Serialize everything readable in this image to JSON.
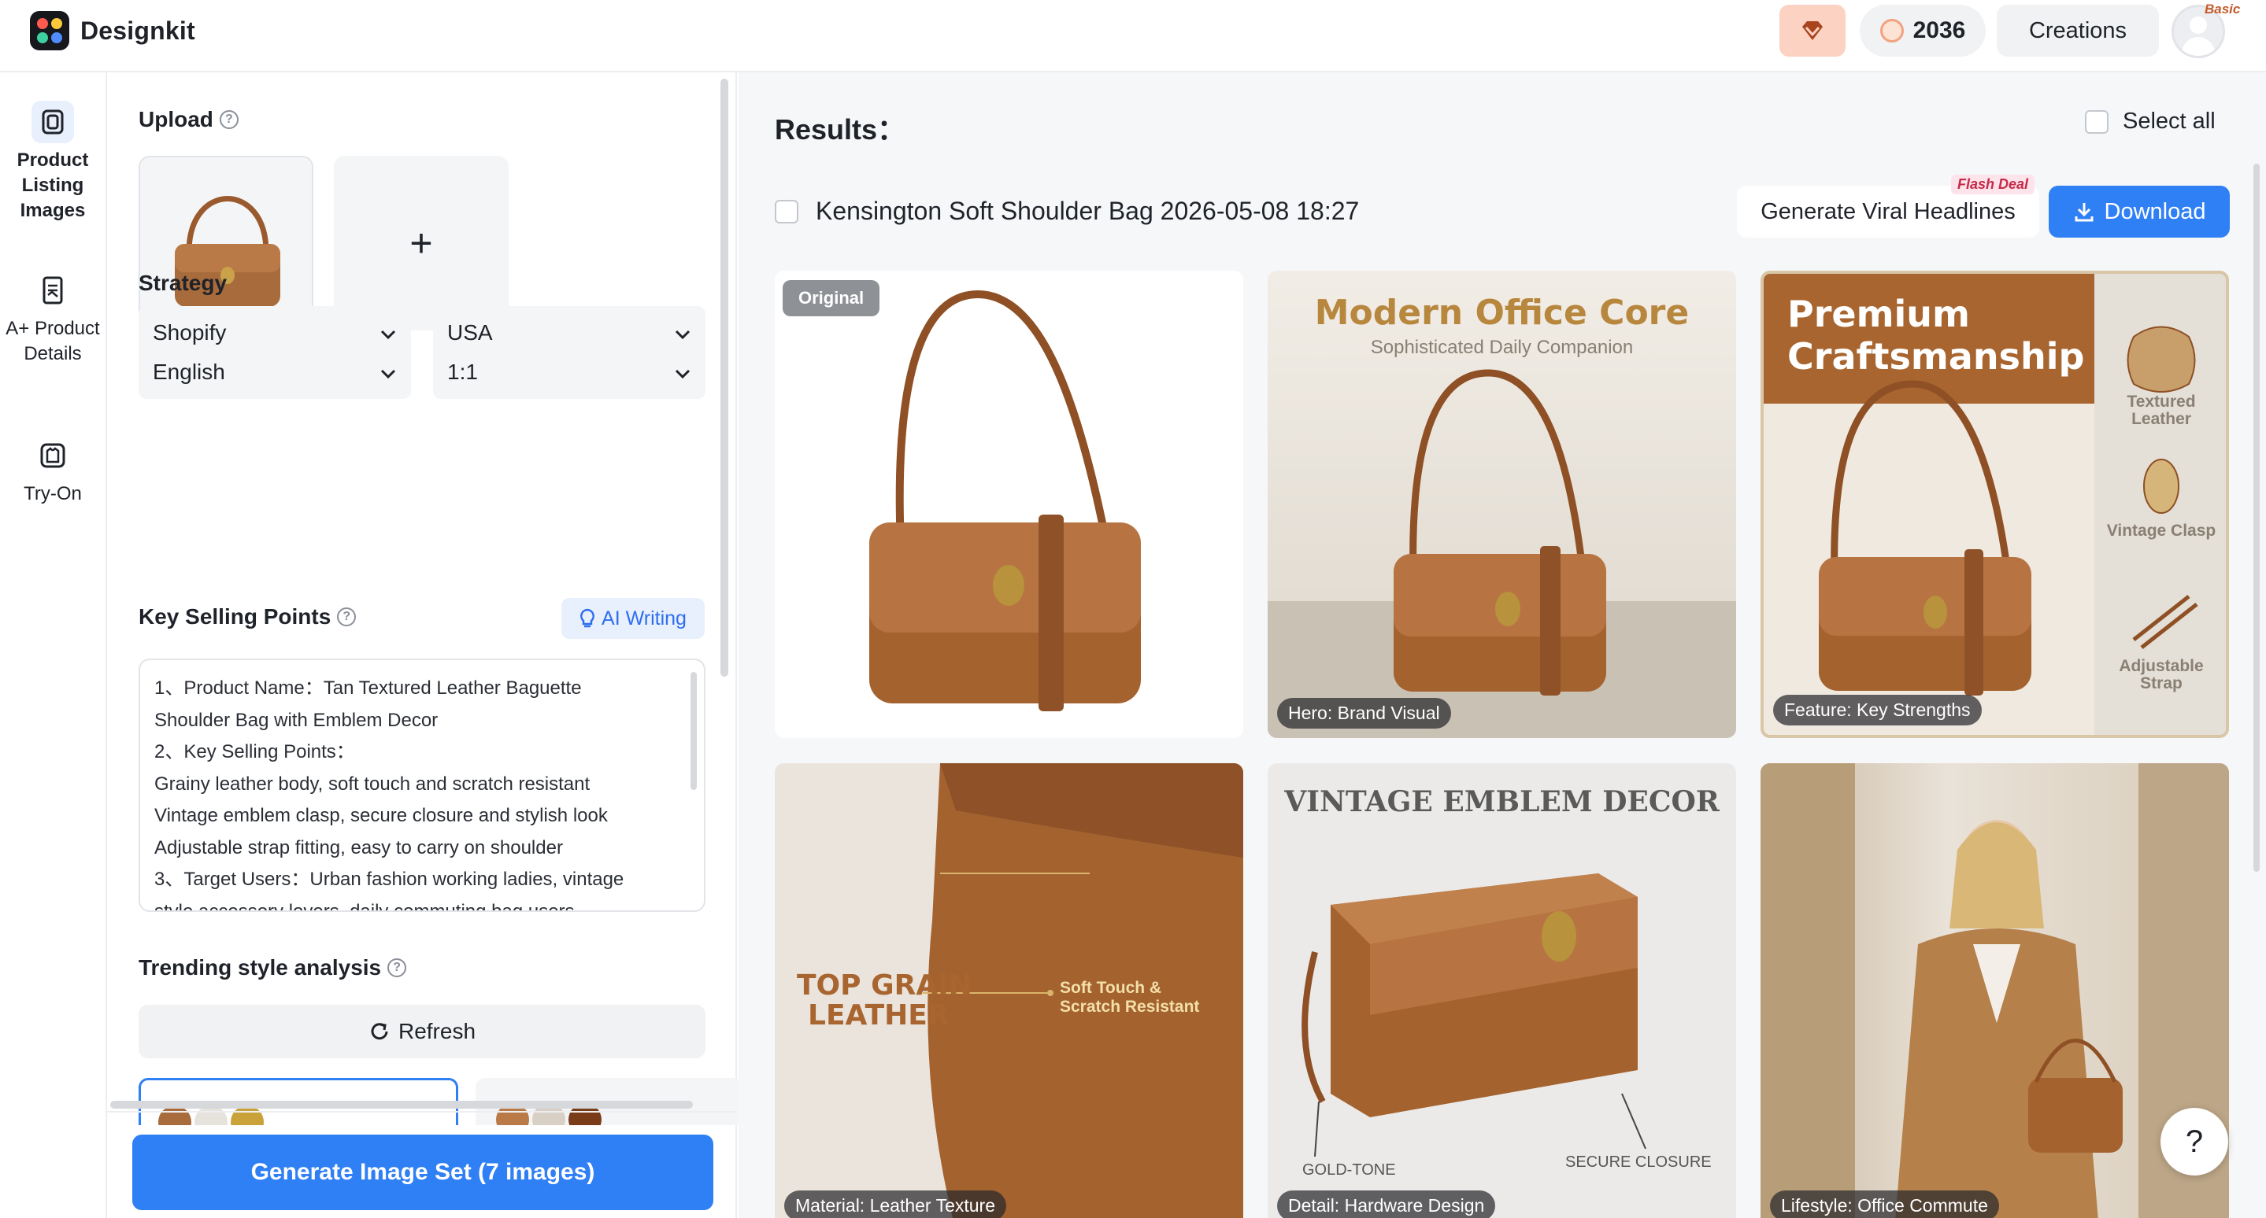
{
  "app": {
    "name": "Designkit",
    "colors": {
      "accent": "#2f7ff5",
      "brand_tan": "#a86b3c"
    }
  },
  "header": {
    "credits": "2036",
    "creations_label": "Creations",
    "plan_badge": "Basic",
    "icons": [
      "gem-icon",
      "coin-icon",
      "avatar-icon"
    ]
  },
  "rail": {
    "items": [
      {
        "label": "Product Listing Images",
        "icon": "product-listing-icon",
        "active": true
      },
      {
        "label": "A+ Product Details",
        "icon": "a-plus-details-icon",
        "active": false
      },
      {
        "label": "Try-On",
        "icon": "try-on-icon",
        "active": false
      }
    ]
  },
  "panel": {
    "upload_title": "Upload",
    "add_symbol": "+",
    "strategy_title": "Strategy",
    "platform": "Shopify",
    "country": "USA",
    "language": "English",
    "ratio": "1:1",
    "ksp_title": "Key Selling Points",
    "ai_writing_label": "AI Writing",
    "ksp_lines": [
      "1、Product Name：Tan Textured Leather Baguette",
      "Shoulder Bag with Emblem Decor",
      "2、Key Selling Points：",
      "Grainy leather body, soft touch and scratch resistant",
      "Vintage emblem clasp, secure closure and stylish look",
      "Adjustable strap fitting, easy to carry on shoulder",
      "3、Target Users：Urban fashion working ladies, vintage",
      "style accessory lovers, daily commuting bag users"
    ],
    "trending_title": "Trending style analysis",
    "refresh_label": "Refresh",
    "generate_label": "Generate Image Set (7 images)"
  },
  "results": {
    "title": "Results：",
    "select_all_label": "Select all",
    "set_name": "Kensington Soft Shoulder Bag 2026-05-08 18:27",
    "viral_label": "Generate Viral Headlines",
    "flash_badge": "Flash Deal",
    "download_label": "Download",
    "help_label": "?",
    "cards": [
      {
        "tag": "Original",
        "caption": ""
      },
      {
        "headline": "Modern Office Core",
        "subhead": "Sophisticated Daily Companion",
        "caption": "Hero: Brand Visual"
      },
      {
        "headline_1": "Premium",
        "headline_2": "Craftsmanship",
        "features": [
          "Textured Leather",
          "Vintage Clasp",
          "Adjustable Strap"
        ],
        "caption": "Feature: Key Strengths"
      },
      {
        "headline_1": "TOP GRAIN",
        "headline_2": "LEATHER",
        "note_1": "Soft Touch &",
        "note_2": "Scratch Resistant",
        "caption": "Material: Leather Texture"
      },
      {
        "headline": "VINTAGE EMBLEM DECOR",
        "label_left": "GOLD-TONE",
        "label_right": "SECURE CLOSURE",
        "caption": "Detail: Hardware Design"
      },
      {
        "caption": "Lifestyle: Office Commute"
      }
    ]
  }
}
